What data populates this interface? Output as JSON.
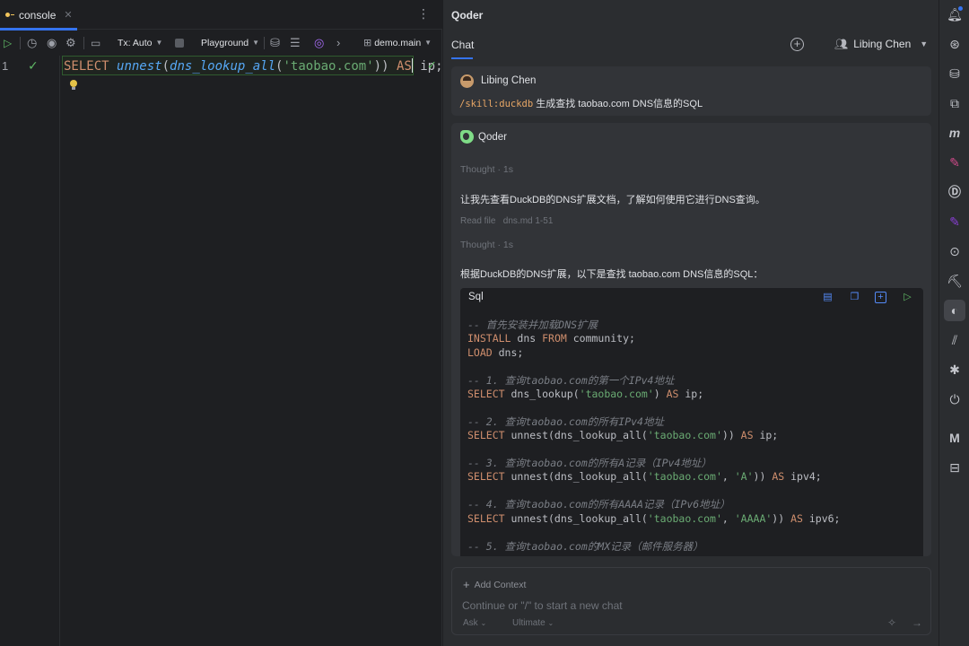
{
  "editor": {
    "tab_label": "console",
    "toolbar": {
      "tx_mode": "Tx: Auto",
      "schema": "Playground",
      "database": "demo.main"
    },
    "line_number": "1",
    "query": {
      "kw1": "SELECT",
      "fn1": "unnest",
      "p1": "(",
      "fn2": "dns_lookup_all",
      "p2": "(",
      "str": "'taobao.com'",
      "p3": ")) ",
      "kw2": "AS",
      "rest": " ip;"
    }
  },
  "chat": {
    "panel_title": "Qoder",
    "tab_label": "Chat",
    "current_user": "Libing Chen",
    "user_message": {
      "author": "Libing Chen",
      "skill": "/skill:duckdb",
      "text": " 生成查找 taobao.com DNS信息的SQL"
    },
    "bot_message": {
      "author": "Qoder",
      "thought1": "Thought · 1s",
      "para1": "让我先查看DuckDB的DNS扩展文档，了解如何使用它进行DNS查询。",
      "read_file": "Read file   dns.md 1-51",
      "thought2": "Thought · 1s",
      "para2": "根据DuckDB的DNS扩展，以下是查找 taobao.com DNS信息的SQL：",
      "code_language": "Sql",
      "code_lines": [
        [
          [
            "cmt",
            "-- 首先安装并加载DNS扩展"
          ]
        ],
        [
          [
            "kw",
            "INSTALL"
          ],
          [
            "",
            " dns "
          ],
          [
            "kw",
            "FROM"
          ],
          [
            "",
            " community;"
          ]
        ],
        [
          [
            "kw",
            "LOAD"
          ],
          [
            "",
            " dns;"
          ]
        ],
        [
          [
            "",
            ""
          ]
        ],
        [
          [
            "cmt",
            "-- 1. 查询taobao.com的第一个IPv4地址"
          ]
        ],
        [
          [
            "kw",
            "SELECT"
          ],
          [
            "",
            " dns_lookup("
          ],
          [
            "str",
            "'taobao.com'"
          ],
          [
            "",
            ") "
          ],
          [
            "kw",
            "AS"
          ],
          [
            "",
            " ip;"
          ]
        ],
        [
          [
            "",
            ""
          ]
        ],
        [
          [
            "cmt",
            "-- 2. 查询taobao.com的所有IPv4地址"
          ]
        ],
        [
          [
            "kw",
            "SELECT"
          ],
          [
            "",
            " unnest(dns_lookup_all("
          ],
          [
            "str",
            "'taobao.com'"
          ],
          [
            "",
            ")) "
          ],
          [
            "kw",
            "AS"
          ],
          [
            "",
            " ip;"
          ]
        ],
        [
          [
            "",
            ""
          ]
        ],
        [
          [
            "cmt",
            "-- 3. 查询taobao.com的所有A记录（IPv4地址）"
          ]
        ],
        [
          [
            "kw",
            "SELECT"
          ],
          [
            "",
            " unnest(dns_lookup_all("
          ],
          [
            "str",
            "'taobao.com'"
          ],
          [
            "",
            ", "
          ],
          [
            "str",
            "'A'"
          ],
          [
            "",
            ")) "
          ],
          [
            "kw",
            "AS"
          ],
          [
            "",
            " ipv4;"
          ]
        ],
        [
          [
            "",
            ""
          ]
        ],
        [
          [
            "cmt",
            "-- 4. 查询taobao.com的所有AAAA记录（IPv6地址）"
          ]
        ],
        [
          [
            "kw",
            "SELECT"
          ],
          [
            "",
            " unnest(dns_lookup_all("
          ],
          [
            "str",
            "'taobao.com'"
          ],
          [
            "",
            ", "
          ],
          [
            "str",
            "'AAAA'"
          ],
          [
            "",
            ")) "
          ],
          [
            "kw",
            "AS"
          ],
          [
            "",
            " ipv6;"
          ]
        ],
        [
          [
            "",
            ""
          ]
        ],
        [
          [
            "cmt",
            "-- 5. 查询taobao.com的MX记录（邮件服务器）"
          ]
        ]
      ]
    },
    "input": {
      "add_context": "Add Context",
      "placeholder": "Continue or \"/\" to start a new chat",
      "mode": "Ask",
      "model": "Ultimate"
    }
  },
  "right_toolbar_icons": [
    "bell-icon",
    "ai-assistant-icon",
    "database-icon",
    "structure-icon",
    "m-icon",
    "plugin-icon",
    "d-icon",
    "purple-icon",
    "sync-icon",
    "brush-icon",
    "qoder-icon",
    "chart-icon",
    "bug-icon",
    "plug-icon",
    "gmail-icon",
    "toolbox-icon"
  ]
}
